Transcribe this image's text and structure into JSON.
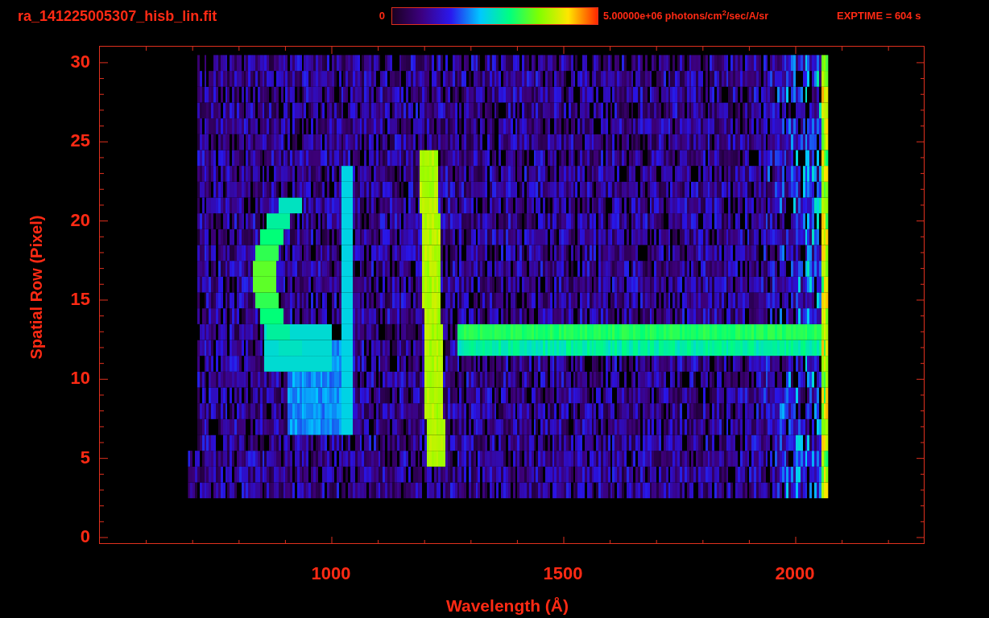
{
  "title": "ra_141225005307_hisb_lin.fit",
  "colorbar": {
    "min_label": "0",
    "max_label": "5.00000e+06 photons/cm$^{2}$/sec/A/sr"
  },
  "exptime": "EXPTIME = 604 s",
  "y_axis": {
    "label": "Spatial Row (Pixel)",
    "ticks": [
      "30",
      "25",
      "20",
      "15",
      "10",
      "5",
      "0"
    ]
  },
  "x_axis": {
    "label": "Wavelength (Å)",
    "ticks": [
      "1000",
      "1500",
      "2000"
    ]
  }
}
